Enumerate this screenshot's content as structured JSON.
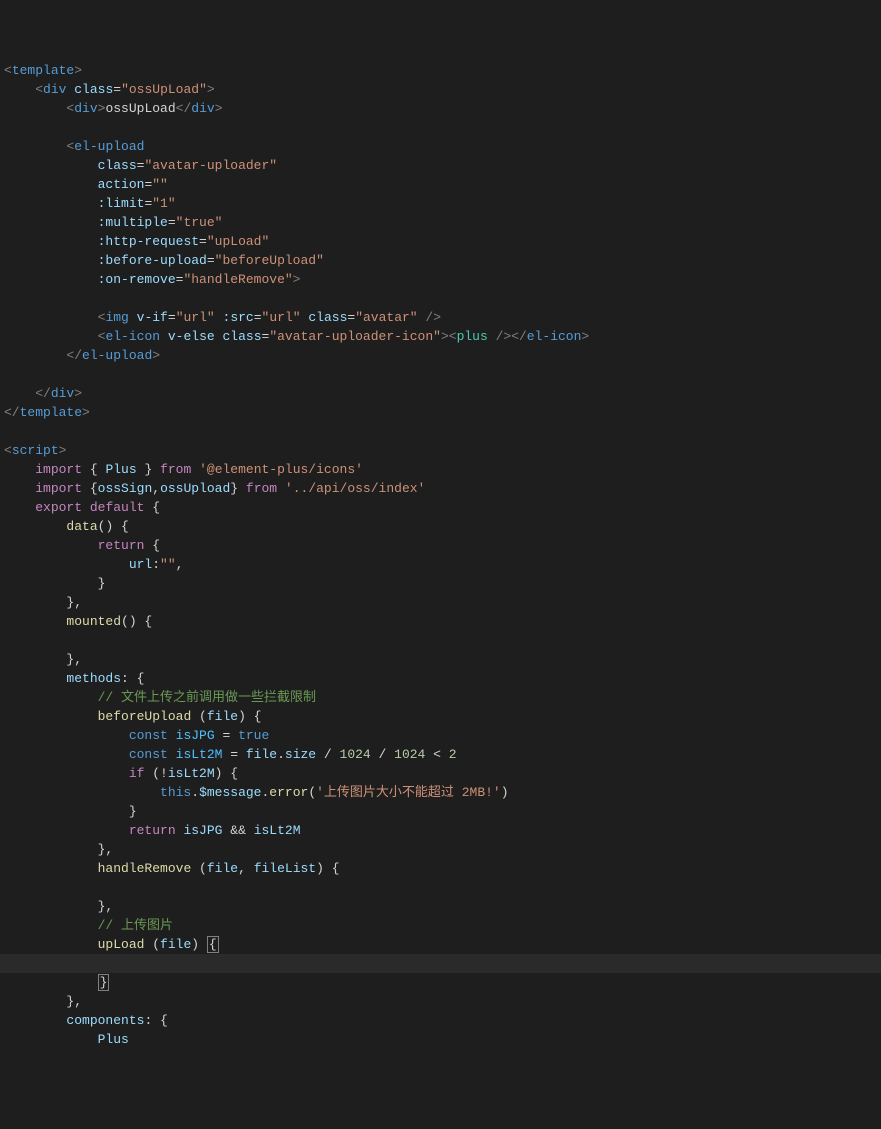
{
  "lines": [
    {
      "indent": 0,
      "type": "open",
      "tag": "template"
    },
    {
      "indent": 1,
      "type": "open",
      "tag": "div",
      "attrs": [
        {
          "n": "class",
          "v": "ossUpLoad"
        }
      ]
    },
    {
      "indent": 2,
      "type": "inline",
      "tag": "div",
      "text": "ossUpLoad",
      "close": "div"
    },
    {
      "indent": 0,
      "type": "blank"
    },
    {
      "indent": 2,
      "type": "open-nc",
      "tag": "el-upload"
    },
    {
      "indent": 3,
      "type": "attrline",
      "n": "class",
      "v": "avatar-uploader"
    },
    {
      "indent": 3,
      "type": "attrline",
      "n": "action",
      "v": ""
    },
    {
      "indent": 3,
      "type": "attrline",
      "n": ":limit",
      "v": "1"
    },
    {
      "indent": 3,
      "type": "attrline",
      "n": ":multiple",
      "v": "true"
    },
    {
      "indent": 3,
      "type": "attrline",
      "n": ":http-request",
      "v": "upLoad"
    },
    {
      "indent": 3,
      "type": "attrline",
      "n": ":before-upload",
      "v": "beforeUpload"
    },
    {
      "indent": 3,
      "type": "attrline-close",
      "n": ":on-remove",
      "v": "handleRemove"
    },
    {
      "indent": 0,
      "type": "blank"
    },
    {
      "indent": 3,
      "type": "img",
      "tag": "img",
      "attrs": [
        {
          "n": "v-if",
          "v": "url"
        },
        {
          "n": ":src",
          "v": "url"
        },
        {
          "n": "class",
          "v": "avatar"
        }
      ]
    },
    {
      "indent": 3,
      "type": "elicon",
      "outer": "el-icon",
      "outerAttrs": [
        {
          "n": "v-else"
        },
        {
          "n": "class",
          "v": "avatar-uploader-icon"
        }
      ],
      "inner": "plus"
    },
    {
      "indent": 2,
      "type": "close",
      "tag": "el-upload"
    },
    {
      "indent": 0,
      "type": "blank"
    },
    {
      "indent": 1,
      "type": "close",
      "tag": "div"
    },
    {
      "indent": 0,
      "type": "close",
      "tag": "template"
    },
    {
      "indent": 0,
      "type": "blank"
    },
    {
      "indent": 0,
      "type": "open",
      "tag": "script"
    },
    {
      "indent": 1,
      "type": "code",
      "tokens": [
        [
          "kw",
          "import"
        ],
        [
          "txt",
          " { "
        ],
        [
          "attr",
          "Plus"
        ],
        [
          "txt",
          " } "
        ],
        [
          "kw",
          "from"
        ],
        [
          "txt",
          " "
        ],
        [
          "str",
          "'@element-plus/icons'"
        ]
      ]
    },
    {
      "indent": 1,
      "type": "code",
      "tokens": [
        [
          "kw",
          "import"
        ],
        [
          "txt",
          " {"
        ],
        [
          "attr",
          "ossSign"
        ],
        [
          "txt",
          ","
        ],
        [
          "attr",
          "ossUpload"
        ],
        [
          "txt",
          "} "
        ],
        [
          "kw",
          "from"
        ],
        [
          "txt",
          " "
        ],
        [
          "str",
          "'../api/oss/index'"
        ]
      ]
    },
    {
      "indent": 1,
      "type": "code",
      "tokens": [
        [
          "kw",
          "export"
        ],
        [
          "txt",
          " "
        ],
        [
          "kw",
          "default"
        ],
        [
          "txt",
          " {"
        ]
      ]
    },
    {
      "indent": 2,
      "type": "code",
      "tokens": [
        [
          "func",
          "data"
        ],
        [
          "txt",
          "() {"
        ]
      ]
    },
    {
      "indent": 3,
      "type": "code",
      "tokens": [
        [
          "kw",
          "return"
        ],
        [
          "txt",
          " {"
        ]
      ]
    },
    {
      "indent": 4,
      "type": "code",
      "tokens": [
        [
          "attr",
          "url"
        ],
        [
          "txt",
          ":"
        ],
        [
          "str",
          "\"\""
        ],
        [
          "txt",
          ","
        ]
      ]
    },
    {
      "indent": 3,
      "type": "code",
      "tokens": [
        [
          "txt",
          "}"
        ]
      ]
    },
    {
      "indent": 2,
      "type": "code",
      "tokens": [
        [
          "txt",
          "},"
        ]
      ]
    },
    {
      "indent": 2,
      "type": "code",
      "tokens": [
        [
          "func",
          "mounted"
        ],
        [
          "txt",
          "() {"
        ]
      ]
    },
    {
      "indent": 0,
      "type": "blank"
    },
    {
      "indent": 2,
      "type": "code",
      "tokens": [
        [
          "txt",
          "},"
        ]
      ]
    },
    {
      "indent": 2,
      "type": "code",
      "tokens": [
        [
          "attr",
          "methods"
        ],
        [
          "txt",
          ": {"
        ]
      ]
    },
    {
      "indent": 3,
      "type": "code",
      "tokens": [
        [
          "cmt",
          "// 文件上传之前调用做一些拦截限制"
        ]
      ]
    },
    {
      "indent": 3,
      "type": "code",
      "tokens": [
        [
          "func",
          "beforeUpload"
        ],
        [
          "txt",
          " ("
        ],
        [
          "attr",
          "file"
        ],
        [
          "txt",
          ") {"
        ]
      ]
    },
    {
      "indent": 4,
      "type": "code",
      "tokens": [
        [
          "blue",
          "const"
        ],
        [
          "txt",
          " "
        ],
        [
          "const",
          "isJPG"
        ],
        [
          "txt",
          " = "
        ],
        [
          "blue",
          "true"
        ]
      ]
    },
    {
      "indent": 4,
      "type": "code",
      "tokens": [
        [
          "blue",
          "const"
        ],
        [
          "txt",
          " "
        ],
        [
          "const",
          "isLt2M"
        ],
        [
          "txt",
          " = "
        ],
        [
          "attr",
          "file"
        ],
        [
          "txt",
          "."
        ],
        [
          "attr",
          "size"
        ],
        [
          "txt",
          " / "
        ],
        [
          "num",
          "1024"
        ],
        [
          "txt",
          " / "
        ],
        [
          "num",
          "1024"
        ],
        [
          "txt",
          " < "
        ],
        [
          "num",
          "2"
        ]
      ]
    },
    {
      "indent": 4,
      "type": "code",
      "tokens": [
        [
          "kw",
          "if"
        ],
        [
          "txt",
          " (!"
        ],
        [
          "attr",
          "isLt2M"
        ],
        [
          "txt",
          ") {"
        ]
      ]
    },
    {
      "indent": 5,
      "type": "code",
      "tokens": [
        [
          "blue",
          "this"
        ],
        [
          "txt",
          "."
        ],
        [
          "attr",
          "$message"
        ],
        [
          "txt",
          "."
        ],
        [
          "func",
          "error"
        ],
        [
          "txt",
          "("
        ],
        [
          "str",
          "'上传图片大小不能超过 2MB!'"
        ],
        [
          "txt",
          ")"
        ]
      ]
    },
    {
      "indent": 4,
      "type": "code",
      "tokens": [
        [
          "txt",
          "}"
        ]
      ]
    },
    {
      "indent": 4,
      "type": "code",
      "tokens": [
        [
          "kw",
          "return"
        ],
        [
          "txt",
          " "
        ],
        [
          "attr",
          "isJPG"
        ],
        [
          "txt",
          " && "
        ],
        [
          "attr",
          "isLt2M"
        ]
      ]
    },
    {
      "indent": 3,
      "type": "code",
      "tokens": [
        [
          "txt",
          "},"
        ]
      ]
    },
    {
      "indent": 3,
      "type": "code",
      "tokens": [
        [
          "func",
          "handleRemove"
        ],
        [
          "txt",
          " ("
        ],
        [
          "attr",
          "file"
        ],
        [
          "txt",
          ", "
        ],
        [
          "attr",
          "fileList"
        ],
        [
          "txt",
          ") {"
        ]
      ]
    },
    {
      "indent": 0,
      "type": "blank"
    },
    {
      "indent": 3,
      "type": "code",
      "tokens": [
        [
          "txt",
          "},"
        ]
      ]
    },
    {
      "indent": 3,
      "type": "code",
      "tokens": [
        [
          "cmt",
          "// 上传图片"
        ]
      ]
    },
    {
      "indent": 3,
      "type": "code",
      "tokens": [
        [
          "func",
          "upLoad"
        ],
        [
          "txt",
          " ("
        ],
        [
          "attr",
          "file"
        ],
        [
          "txt",
          ") "
        ],
        [
          "box",
          "{"
        ]
      ]
    },
    {
      "indent": 0,
      "type": "blank",
      "cursor": true
    },
    {
      "indent": 3,
      "type": "code",
      "tokens": [
        [
          "box",
          "}"
        ]
      ]
    },
    {
      "indent": 2,
      "type": "code",
      "tokens": [
        [
          "txt",
          "},"
        ]
      ]
    },
    {
      "indent": 2,
      "type": "code",
      "tokens": [
        [
          "attr",
          "components"
        ],
        [
          "txt",
          ": {"
        ]
      ]
    },
    {
      "indent": 3,
      "type": "code",
      "tokens": [
        [
          "attr",
          "Plus"
        ]
      ]
    }
  ]
}
